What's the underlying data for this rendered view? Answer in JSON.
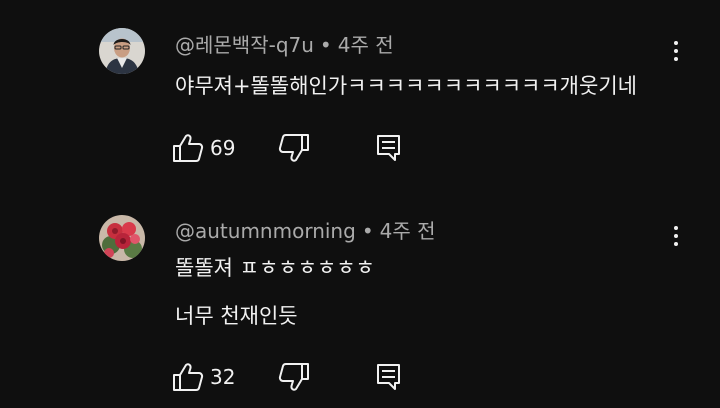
{
  "comments": [
    {
      "author": "@레몬백작-q7u",
      "separator": "•",
      "time": "4주 전",
      "lines": [
        "야무져+똘똘해인가ㅋㅋㅋㅋㅋㅋㅋㅋㅋㅋㅋ개웃기네"
      ],
      "likes": "69",
      "avatar_icon": "person-avatar"
    },
    {
      "author": "@autumnmorning",
      "separator": "•",
      "time": "4주 전",
      "lines": [
        "똘똘져 ㅍㅎㅎㅎㅎㅎㅎ",
        "너무 천재인듯"
      ],
      "likes": "32",
      "avatar_icon": "rose-avatar"
    }
  ],
  "icons": {
    "like": "thumbs-up-icon",
    "dislike": "thumbs-down-icon",
    "reply": "reply-icon",
    "more": "more-vert-icon"
  },
  "colors": {
    "background": "#0f0f0f",
    "text": "#f1f1f1",
    "meta": "#aaaaaa"
  }
}
